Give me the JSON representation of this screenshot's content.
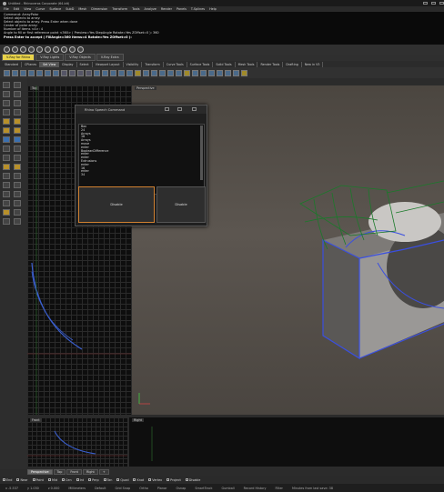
{
  "window": {
    "title": "Untitled - Rhinoceros Corporate (64-bit)"
  },
  "menu": [
    "File",
    "Edit",
    "View",
    "Curve",
    "Surface",
    "SubD",
    "Mesh",
    "Dimension",
    "Transform",
    "Tools",
    "Analyze",
    "Render",
    "Panels",
    "T-Splines",
    "Help"
  ],
  "command_history": [
    "Command: ArrayPolar",
    "Select objects to array:",
    "Select objects to array. Press Enter when done",
    "Center of polar array:",
    "Number of items <4>: 4",
    "Angle to fill or first reference point <360> ( Preview=Yes  StepAngle  Rotate=Yes  ZOffset=0 ): 360",
    "Press Enter to accept ( FillAngle=360  Items=4  Rotate=Yes  ZOffset=0 ):"
  ],
  "ribbon_tabs": [
    {
      "label": "V-Ray for Rhino",
      "active": true
    },
    {
      "label": "V-Ray Lights",
      "active": false
    },
    {
      "label": "V-Ray Objects",
      "active": false
    },
    {
      "label": "V-Ray Extra",
      "active": false
    }
  ],
  "toolbar_tabs": [
    {
      "label": "Standard",
      "active": false
    },
    {
      "label": "CPlanes",
      "active": false
    },
    {
      "label": "Set View",
      "active": true
    },
    {
      "label": "Display",
      "active": false
    },
    {
      "label": "Select",
      "active": false
    },
    {
      "label": "Viewport Layout",
      "active": false
    },
    {
      "label": "Visibility",
      "active": false
    },
    {
      "label": "Transform",
      "active": false
    },
    {
      "label": "Curve Tools",
      "active": false
    },
    {
      "label": "Surface Tools",
      "active": false
    },
    {
      "label": "Solid Tools",
      "active": false
    },
    {
      "label": "Mesh Tools",
      "active": false
    },
    {
      "label": "Render Tools",
      "active": false
    },
    {
      "label": "Drafting",
      "active": false
    },
    {
      "label": "New in V5",
      "active": false
    }
  ],
  "viewports": {
    "top": "Top",
    "perspective": "Perspective",
    "front": "Front",
    "right": "Right"
  },
  "viewport_tabs": [
    {
      "label": "Perspective",
      "active": true
    },
    {
      "label": "Top",
      "active": false
    },
    {
      "label": "Front",
      "active": false
    },
    {
      "label": "Right",
      "active": false
    }
  ],
  "osnaps": [
    "End",
    "Near",
    "Point",
    "Mid",
    "Cen",
    "Int",
    "Perp",
    "Tan",
    "Quad",
    "Knot",
    "Vertex",
    "Project",
    "Disable"
  ],
  "status": [
    "x -5.537",
    "y 1.030",
    "z 0.000",
    "Millimeters",
    "Default",
    "Grid Snap",
    "Ortho",
    "Planar",
    "Osnap",
    "SmartTrack",
    "Gumball",
    "Record History",
    "Filter",
    "Minutes from last save: 38"
  ],
  "dialog": {
    "title": "Rhino Speech Command",
    "list": [
      "Box",
      "24",
      "Arrays",
      "16",
      "Arrays",
      "move",
      "enter",
      "BooleanDifference",
      "enter",
      "enter",
      "Extrusions",
      "enter",
      "16",
      "enter",
      "34"
    ],
    "primary_button": "Disable",
    "secondary_button": "Disable"
  }
}
